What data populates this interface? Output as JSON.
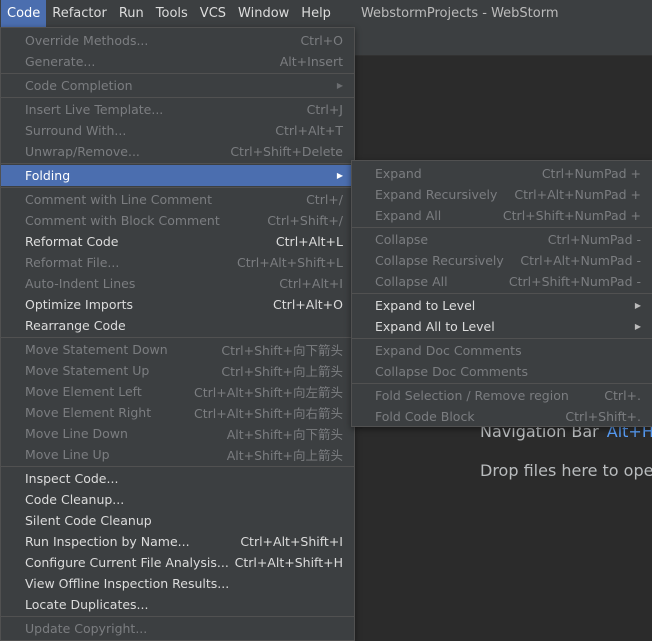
{
  "menubar": {
    "items": [
      "Code",
      "Refactor",
      "Run",
      "Tools",
      "VCS",
      "Window",
      "Help"
    ],
    "window_title": "WebstormProjects - WebStorm"
  },
  "editor_hints": {
    "navigation_bar": "Navigation Bar",
    "navigation_bar_key": "Alt+Ho",
    "drop_files": "Drop files here to open"
  },
  "code_menu": {
    "groups": [
      [
        {
          "label": "Override Methods...",
          "shortcut": "Ctrl+O",
          "enabled": false
        },
        {
          "label": "Generate...",
          "shortcut": "Alt+Insert",
          "enabled": false
        }
      ],
      [
        {
          "label": "Code Completion",
          "shortcut": "",
          "enabled": false,
          "submenu": true
        }
      ],
      [
        {
          "label": "Insert Live Template...",
          "shortcut": "Ctrl+J",
          "enabled": false
        },
        {
          "label": "Surround With...",
          "shortcut": "Ctrl+Alt+T",
          "enabled": false
        },
        {
          "label": "Unwrap/Remove...",
          "shortcut": "Ctrl+Shift+Delete",
          "enabled": false
        }
      ],
      [
        {
          "label": "Folding",
          "shortcut": "",
          "enabled": true,
          "submenu": true,
          "selected": true
        }
      ],
      [
        {
          "label": "Comment with Line Comment",
          "shortcut": "Ctrl+/",
          "enabled": false
        },
        {
          "label": "Comment with Block Comment",
          "shortcut": "Ctrl+Shift+/",
          "enabled": false
        },
        {
          "label": "Reformat Code",
          "shortcut": "Ctrl+Alt+L",
          "enabled": true
        },
        {
          "label": "Reformat File...",
          "shortcut": "Ctrl+Alt+Shift+L",
          "enabled": false
        },
        {
          "label": "Auto-Indent Lines",
          "shortcut": "Ctrl+Alt+I",
          "enabled": false
        },
        {
          "label": "Optimize Imports",
          "shortcut": "Ctrl+Alt+O",
          "enabled": true
        },
        {
          "label": "Rearrange Code",
          "shortcut": "",
          "enabled": true
        }
      ],
      [
        {
          "label": "Move Statement Down",
          "shortcut": "Ctrl+Shift+向下箭头",
          "enabled": false
        },
        {
          "label": "Move Statement Up",
          "shortcut": "Ctrl+Shift+向上箭头",
          "enabled": false
        },
        {
          "label": "Move Element Left",
          "shortcut": "Ctrl+Alt+Shift+向左箭头",
          "enabled": false
        },
        {
          "label": "Move Element Right",
          "shortcut": "Ctrl+Alt+Shift+向右箭头",
          "enabled": false
        },
        {
          "label": "Move Line Down",
          "shortcut": "Alt+Shift+向下箭头",
          "enabled": false
        },
        {
          "label": "Move Line Up",
          "shortcut": "Alt+Shift+向上箭头",
          "enabled": false
        }
      ],
      [
        {
          "label": "Inspect Code...",
          "shortcut": "",
          "enabled": true
        },
        {
          "label": "Code Cleanup...",
          "shortcut": "",
          "enabled": true
        },
        {
          "label": "Silent Code Cleanup",
          "shortcut": "",
          "enabled": true
        },
        {
          "label": "Run Inspection by Name...",
          "shortcut": "Ctrl+Alt+Shift+I",
          "enabled": true
        },
        {
          "label": "Configure Current File Analysis...",
          "shortcut": "Ctrl+Alt+Shift+H",
          "enabled": true
        },
        {
          "label": "View Offline Inspection Results...",
          "shortcut": "",
          "enabled": true
        },
        {
          "label": "Locate Duplicates...",
          "shortcut": "",
          "enabled": true
        }
      ],
      [
        {
          "label": "Update Copyright...",
          "shortcut": "",
          "enabled": false
        }
      ]
    ]
  },
  "folding_menu": {
    "groups": [
      [
        {
          "label": "Expand",
          "shortcut": "Ctrl+NumPad +",
          "enabled": false
        },
        {
          "label": "Expand Recursively",
          "shortcut": "Ctrl+Alt+NumPad +",
          "enabled": false
        },
        {
          "label": "Expand All",
          "shortcut": "Ctrl+Shift+NumPad +",
          "enabled": false
        }
      ],
      [
        {
          "label": "Collapse",
          "shortcut": "Ctrl+NumPad -",
          "enabled": false
        },
        {
          "label": "Collapse Recursively",
          "shortcut": "Ctrl+Alt+NumPad -",
          "enabled": false
        },
        {
          "label": "Collapse All",
          "shortcut": "Ctrl+Shift+NumPad -",
          "enabled": false
        }
      ],
      [
        {
          "label": "Expand to Level",
          "shortcut": "",
          "enabled": true,
          "submenu": true
        },
        {
          "label": "Expand All to Level",
          "shortcut": "",
          "enabled": true,
          "submenu": true
        }
      ],
      [
        {
          "label": "Expand Doc Comments",
          "shortcut": "",
          "enabled": false
        },
        {
          "label": "Collapse Doc Comments",
          "shortcut": "",
          "enabled": false
        }
      ],
      [
        {
          "label": "Fold Selection / Remove region",
          "shortcut": "Ctrl+.",
          "enabled": false
        },
        {
          "label": "Fold Code Block",
          "shortcut": "Ctrl+Shift+.",
          "enabled": false
        }
      ]
    ]
  },
  "icons": {
    "submenu_arrow": "chevron-right-icon"
  },
  "colors": {
    "selection": "#4b6eaf",
    "menu_bg": "#3c3f41",
    "editor_bg": "#2b2b2b",
    "hint_key": "#589df6"
  }
}
